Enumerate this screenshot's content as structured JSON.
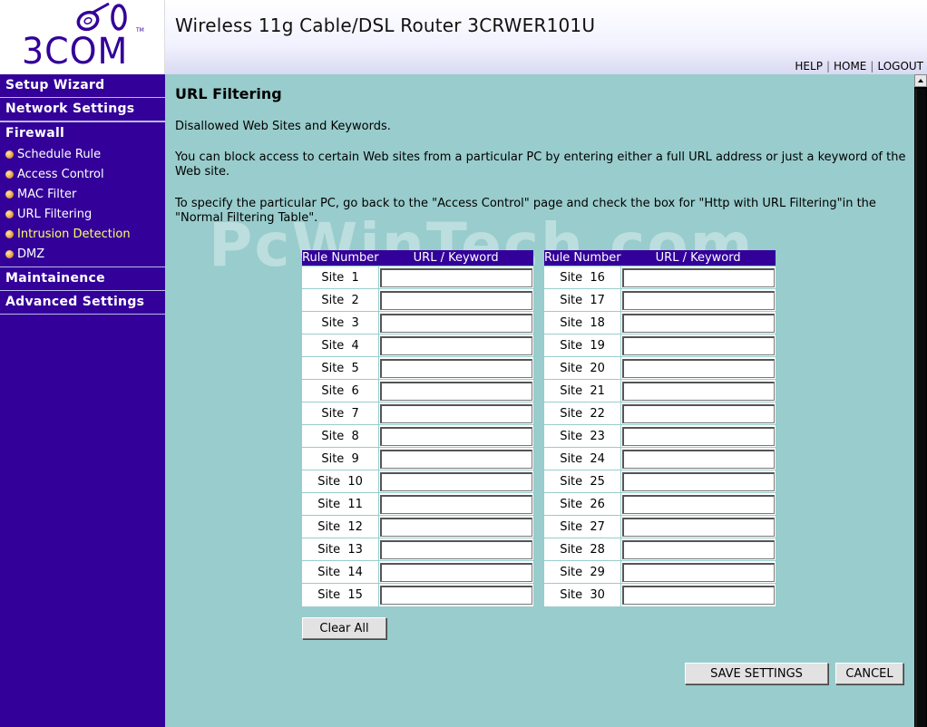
{
  "brand": {
    "logo_text": "3COM",
    "trademark": "TM"
  },
  "header": {
    "product_title": "Wireless 11g Cable/DSL Router 3CRWER101U",
    "links": {
      "help": "HELP",
      "home": "HOME",
      "logout": "LOGOUT"
    }
  },
  "sidebar": {
    "setup_wizard": "Setup Wizard",
    "network_settings": "Network Settings",
    "firewall": "Firewall",
    "firewall_items": [
      "Schedule Rule",
      "Access Control",
      "MAC Filter",
      "URL Filtering",
      "Intrusion Detection",
      "DMZ"
    ],
    "maintenance": "Maintainence",
    "advanced_settings": "Advanced Settings"
  },
  "main": {
    "title": "URL Filtering",
    "subtitle": "Disallowed Web Sites and Keywords.",
    "description": "You can block access to certain Web sites from a particular PC by entering either a full URL address or just a keyword of the Web site.",
    "instruction": "To specify the particular PC, go back to the \"Access Control\" page and check the box for \"Http with URL Filtering\"in the \"Normal Filtering Table\".",
    "watermark": "PcWinTech.com",
    "table": {
      "col_rule": "Rule Number",
      "col_url": "URL / Keyword",
      "left_rows": [
        "Site  1",
        "Site  2",
        "Site  3",
        "Site  4",
        "Site  5",
        "Site  6",
        "Site  7",
        "Site  8",
        "Site  9",
        "Site  10",
        "Site  11",
        "Site  12",
        "Site  13",
        "Site  14",
        "Site  15"
      ],
      "right_rows": [
        "Site  16",
        "Site  17",
        "Site  18",
        "Site  19",
        "Site  20",
        "Site  21",
        "Site  22",
        "Site  23",
        "Site  24",
        "Site  25",
        "Site  26",
        "Site  27",
        "Site  28",
        "Site  29",
        "Site  30"
      ],
      "values_left": [
        "",
        "",
        "",
        "",
        "",
        "",
        "",
        "",
        "",
        "",
        "",
        "",
        "",
        "",
        ""
      ],
      "values_right": [
        "",
        "",
        "",
        "",
        "",
        "",
        "",
        "",
        "",
        "",
        "",
        "",
        "",
        "",
        ""
      ]
    },
    "buttons": {
      "clear_all": "Clear All",
      "save": "SAVE SETTINGS",
      "cancel": "CANCEL"
    }
  },
  "colors": {
    "sidebar": "#330099",
    "content_bg": "#99cccc",
    "active_link": "#ffff66"
  }
}
